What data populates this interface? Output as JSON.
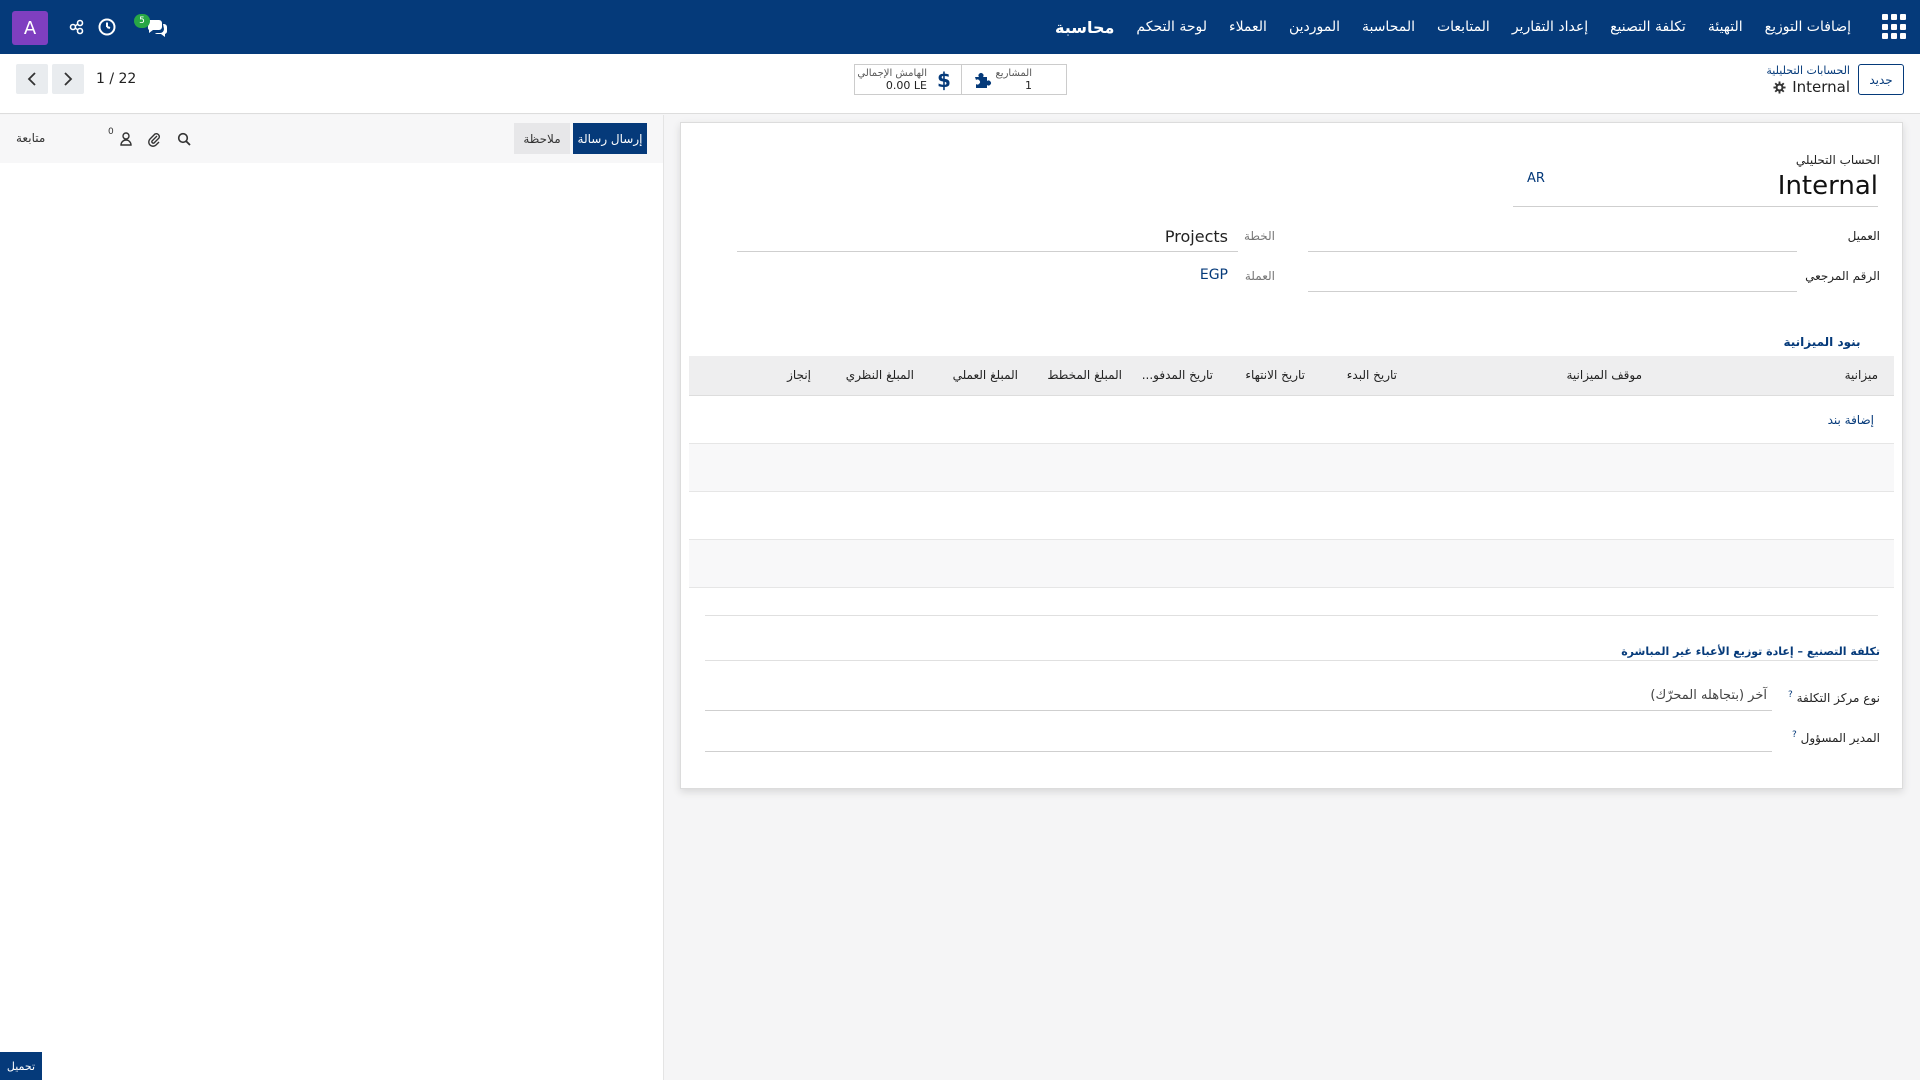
{
  "topbar": {
    "menu": [
      {
        "label": "محاسبة",
        "brand": true
      },
      {
        "label": "لوحة التحكم"
      },
      {
        "label": "العملاء"
      },
      {
        "label": "الموردين"
      },
      {
        "label": "المحاسبة"
      },
      {
        "label": "المتابعات"
      },
      {
        "label": "إعداد التقارير"
      },
      {
        "label": "تكلفة التصنيع"
      },
      {
        "label": "التهيئة"
      },
      {
        "label": "إضافات التوزيع"
      }
    ],
    "avatar_letter": "A",
    "chat_count": "5",
    "colors": {
      "bar": "#053a7a",
      "avatar": "#7f3fc0",
      "badge": "#28a745"
    }
  },
  "cpanel": {
    "new_label": "جديد",
    "breadcrumb_parent": "الحسابات التحليلية",
    "breadcrumb_current": "Internal",
    "stat_projects_label": "المشاريع",
    "stat_projects_value": "1",
    "stat_margin_label": "الهامش الإجمالي",
    "stat_margin_value": "0.00 LE",
    "pager_value": "1 / 22"
  },
  "chatter": {
    "send_label": "إرسال رسالة",
    "note_label": "ملاحظة",
    "follow_label": "متابعة",
    "followers_count": "0",
    "upload_label": "تحميل"
  },
  "form": {
    "name_label": "الحساب التحليلي",
    "name_value": "Internal",
    "lang_code": "AR",
    "customer_label": "العميل",
    "customer_value": "",
    "ref_label": "الرقم المرجعي",
    "ref_value": "",
    "plan_label": "الخطة",
    "plan_value": "Projects",
    "currency_label": "العملة",
    "currency_value": "EGP",
    "tab_label": "بنود الميزانية",
    "columns": [
      "ميزانية",
      "موقف الميزانية",
      "تاريخ البدء",
      "تاريخ الانتهاء",
      "تاريخ المدفو...",
      "المبلغ المخطط",
      "المبلغ العملي",
      "المبلغ النظري",
      "إنجاز"
    ],
    "add_line_label": "إضافة بند",
    "section_title": "تكلفة التصنيع – إعادة توزيع الأعباء غير المباشرة",
    "cost_center_label": "نوع مركز التكلفة",
    "cost_center_value": "آخر (بتجاهله المحرّك)",
    "manager_label": "المدير المسؤول",
    "manager_value": ""
  }
}
